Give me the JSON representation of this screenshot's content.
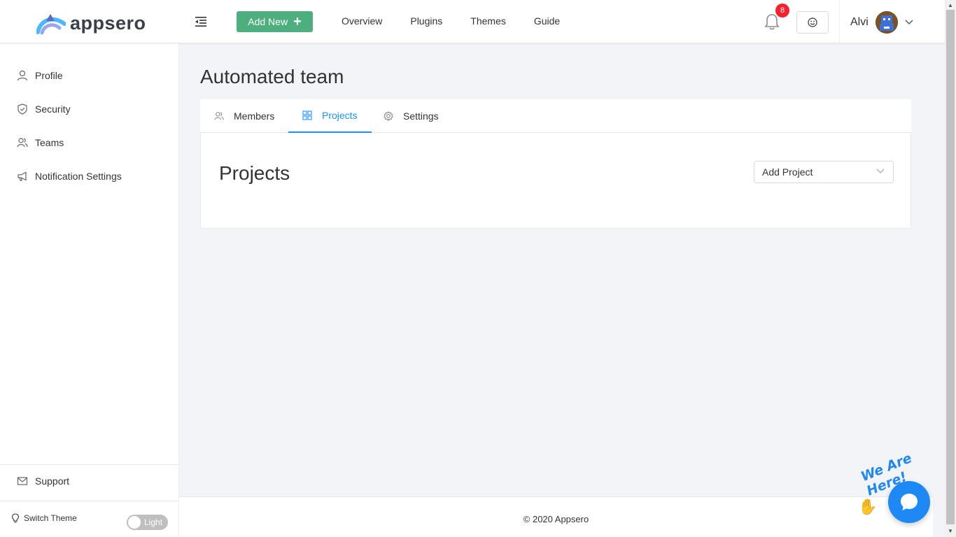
{
  "brand": {
    "name": "appsero"
  },
  "header": {
    "add_new_label": "Add New",
    "nav": [
      "Overview",
      "Plugins",
      "Themes",
      "Guide"
    ],
    "notification_count": "8",
    "user_name": "Alvi"
  },
  "sidebar": {
    "items": [
      {
        "label": "Profile",
        "icon": "user-icon"
      },
      {
        "label": "Security",
        "icon": "shield-icon"
      },
      {
        "label": "Teams",
        "icon": "team-icon"
      },
      {
        "label": "Notification Settings",
        "icon": "megaphone-icon"
      }
    ],
    "support_label": "Support",
    "switch_theme_label": "Switch Theme",
    "theme_toggle_label": "Light"
  },
  "main": {
    "page_title": "Automated team",
    "tabs": [
      {
        "label": "Members",
        "icon": "team-icon"
      },
      {
        "label": "Projects",
        "icon": "grid-icon",
        "active": true
      },
      {
        "label": "Settings",
        "icon": "gear-icon"
      }
    ],
    "card_title": "Projects",
    "add_project_placeholder": "Add Project"
  },
  "footer": {
    "copyright": "© 2020 Appsero"
  },
  "chat": {
    "label": "We Are Here!"
  },
  "colors": {
    "accent": "#1890ff",
    "add_new": "#4caf7d",
    "badge": "#f5222d",
    "chat": "#1e88f5"
  }
}
